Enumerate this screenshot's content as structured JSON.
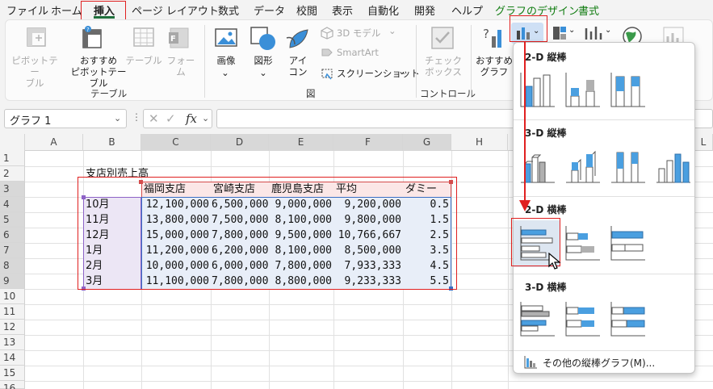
{
  "menu": {
    "tabs": [
      "ファイル",
      "ホーム",
      "挿入",
      "ページ レイアウト",
      "数式",
      "データ",
      "校閲",
      "表示",
      "自動化",
      "開発",
      "ヘルプ",
      "グラフのデザイン",
      "書式"
    ],
    "active_tab": "挿入"
  },
  "ribbon": {
    "pivot_table": "ピボットテー\nブル",
    "recommended_pivot": "おすすめ\nピボットテーブル",
    "table": "テーブル",
    "forms": "フォー\nム",
    "group_table": "テーブル",
    "picture": "画像",
    "shapes": "図形",
    "icons": "アイ\nコン",
    "model_3d": "3D モデル",
    "smartart": "SmartArt",
    "screenshot": "スクリーンショット",
    "group_illustrations": "図",
    "checkbox": "チェック\nボックス",
    "group_controls": "コントロール",
    "recommended_charts": "おすすめ\nグラフ"
  },
  "formula_bar": {
    "name_box": "グラフ 1",
    "fx": "fx",
    "formula": ""
  },
  "sheet": {
    "columns": [
      "A",
      "B",
      "C",
      "D",
      "E",
      "F",
      "G",
      "H",
      "L"
    ],
    "rows": [
      "1",
      "2",
      "3",
      "4",
      "5",
      "6",
      "7",
      "8",
      "9",
      "10",
      "11",
      "12",
      "13",
      "14",
      "15",
      "16"
    ],
    "title": "支店別売上高",
    "headers": [
      "福岡支店",
      "宮崎支店",
      "鹿児島支店",
      "平均",
      "ダミー"
    ],
    "data": [
      {
        "label": "10月",
        "values": [
          "12,100,000",
          "6,500,000",
          "9,000,000",
          "9,200,000",
          "0.5"
        ]
      },
      {
        "label": "11月",
        "values": [
          "13,800,000",
          "7,500,000",
          "8,100,000",
          "9,800,000",
          "1.5"
        ]
      },
      {
        "label": "12月",
        "values": [
          "15,000,000",
          "7,800,000",
          "9,500,000",
          "10,766,667",
          "2.5"
        ]
      },
      {
        "label": "1月",
        "values": [
          "11,200,000",
          "6,200,000",
          "8,100,000",
          "8,500,000",
          "3.5"
        ]
      },
      {
        "label": "2月",
        "values": [
          "10,000,000",
          "6,000,000",
          "7,800,000",
          "7,933,333",
          "4.5"
        ]
      },
      {
        "label": "3月",
        "values": [
          "11,100,000",
          "7,800,000",
          "8,800,000",
          "9,233,333",
          "5.5"
        ]
      }
    ]
  },
  "dropdown": {
    "sections": [
      "2-D 縦棒",
      "3-D 縦棒",
      "2-D 横棒",
      "3-D 横棒"
    ],
    "more": "その他の縦棒グラフ(M)..."
  },
  "colors": {
    "accent_red": "#e02020",
    "bar_blue": "#4a9fe0",
    "bar_gray": "#b0b0b0",
    "excel_green": "#1f6f3b"
  }
}
